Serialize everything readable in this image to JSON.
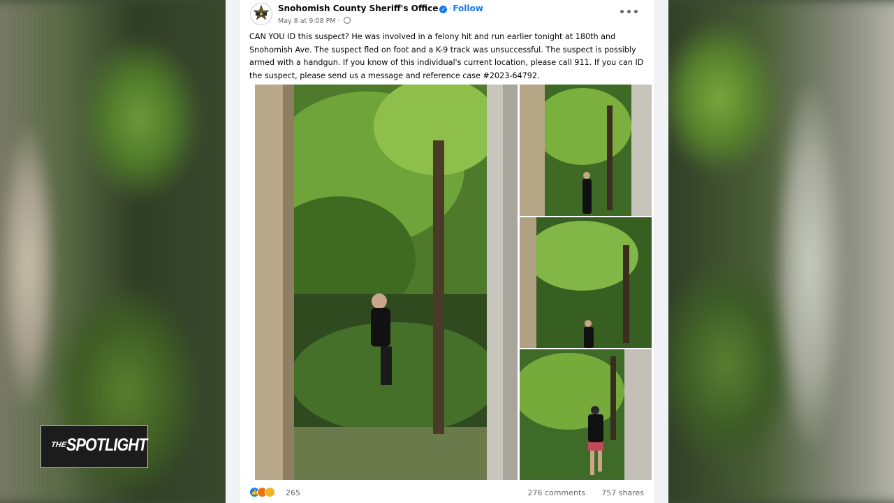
{
  "post": {
    "author": "Snohomish County Sheriff's Office",
    "follow_label": "Follow",
    "timestamp": "May 8 at 9:08 PM",
    "text": "CAN YOU ID this suspect? He was involved in a felony hit and run earlier tonight at 180th and Snohomish Ave. The suspect fled on foot and a K-9 track was unsuccessful. The suspect is possibly armed with a handgun. If you know of this individual's current location, please call 911. If you can ID the suspect, please send us a message and reference case #2023-64792.",
    "more_icon": "•••"
  },
  "engagement": {
    "reaction_count": "265",
    "comments": "276 comments",
    "shares": "757 shares",
    "reaction_icons": [
      "like-icon",
      "angry-icon",
      "wow-icon"
    ]
  },
  "overlay": {
    "logo_the": "THE",
    "logo_word": "SPOTLIGHT"
  },
  "colors": {
    "facebook_blue": "#1877f2",
    "text": "#050505",
    "muted": "#65676b"
  }
}
